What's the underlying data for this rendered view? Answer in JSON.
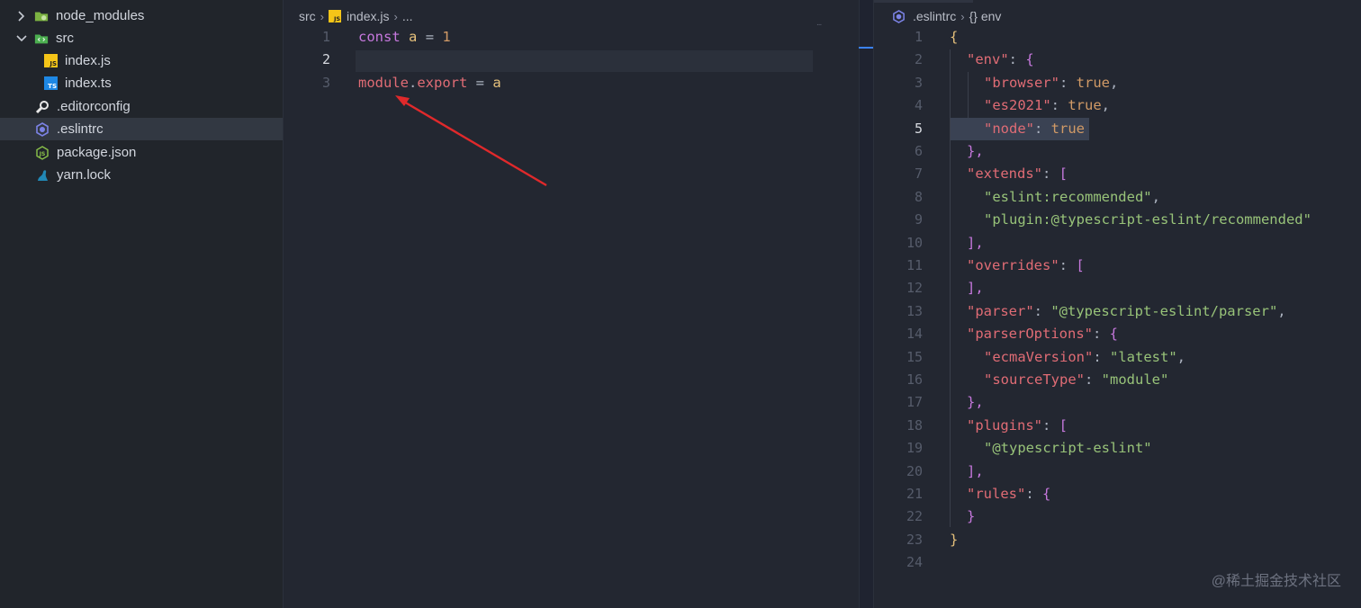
{
  "explorer": {
    "items": [
      {
        "label": "node_modules",
        "icon": "folder-node-icon",
        "chevron": "right"
      },
      {
        "label": "src",
        "icon": "folder-src-icon",
        "chevron": "down"
      },
      {
        "label": "index.js",
        "icon": "js-file-icon",
        "badge": "JS"
      },
      {
        "label": "index.ts",
        "icon": "ts-file-icon",
        "badge": "TS"
      },
      {
        "label": ".editorconfig",
        "icon": "editorconfig-icon"
      },
      {
        "label": ".eslintrc",
        "icon": "eslint-icon"
      },
      {
        "label": "package.json",
        "icon": "nodejs-icon",
        "badge": "JS"
      },
      {
        "label": "yarn.lock",
        "icon": "yarn-icon"
      }
    ]
  },
  "left_editor": {
    "breadcrumb": {
      "folder": "src",
      "file": "index.js",
      "file_badge": "JS",
      "more": "..."
    },
    "line_numbers": [
      "1",
      "2",
      "3"
    ],
    "active_line": "2",
    "code": {
      "l1": {
        "kw": "const",
        "var": "a",
        "op": " = ",
        "num": "1"
      },
      "l3": {
        "obj": "module",
        "dot": ".",
        "prop": "export",
        "op": " = ",
        "var": "a"
      }
    },
    "minimap_hint": "...",
    "annotation_color": "#e0292b"
  },
  "right_editor": {
    "breadcrumb": {
      "file": ".eslintrc",
      "symbol": "{} env"
    },
    "active_line": "5",
    "line_numbers": [
      "1",
      "2",
      "3",
      "4",
      "5",
      "6",
      "7",
      "8",
      "9",
      "10",
      "11",
      "12",
      "13",
      "14",
      "15",
      "16",
      "17",
      "18",
      "19",
      "20",
      "21",
      "22",
      "23",
      "24"
    ],
    "code": {
      "l1": "{",
      "l2_key": "\"env\"",
      "l2_rest": ": {",
      "l3_key": "\"browser\"",
      "l3_val": "true",
      "l4_key": "\"es2021\"",
      "l4_val": "true",
      "l5_key": "\"node\"",
      "l5_val": "true",
      "l6": "},",
      "l7_key": "\"extends\"",
      "l7_rest": ": [",
      "l8": "\"eslint:recommended\"",
      "l9": "\"plugin:@typescript-eslint/recommended\"",
      "l10": "],",
      "l11_key": "\"overrides\"",
      "l11_rest": ": [",
      "l12": "],",
      "l13_key": "\"parser\"",
      "l13_val": "\"@typescript-eslint/parser\"",
      "l14_key": "\"parserOptions\"",
      "l14_rest": ": {",
      "l15_key": "\"ecmaVersion\"",
      "l15_val": "\"latest\"",
      "l16_key": "\"sourceType\"",
      "l16_val": "\"module\"",
      "l17": "},",
      "l18_key": "\"plugins\"",
      "l18_rest": ": [",
      "l19": "\"@typescript-eslint\"",
      "l20": "],",
      "l21_key": "\"rules\"",
      "l21_rest": ": {",
      "l22": "}",
      "l23": "}"
    }
  },
  "watermark": "@稀土掘金技术社区",
  "colors": {
    "sidebar_bg": "#21252b",
    "editor_bg": "#232731",
    "selection": "#323842",
    "keyword": "#c678dd",
    "string": "#98c379",
    "property": "#e06c75",
    "number": "#d19a66"
  }
}
